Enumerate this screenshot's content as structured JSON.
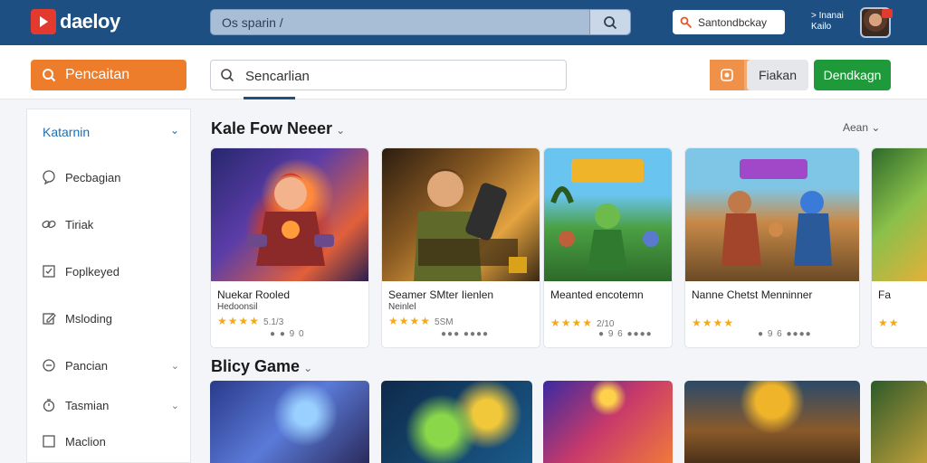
{
  "topbar": {
    "logo_text": "daeloy",
    "search_placeholder": "Os sparin  /",
    "pill_label": "Santondbckay",
    "user_line1": "> Inanai",
    "user_line2": "Kailo"
  },
  "subbar": {
    "orange_button": "Pencaitan",
    "search_value": "Sencarlian",
    "gray_button": "Fiakan",
    "green_button": "Dendkagn"
  },
  "sidebar": {
    "heading": "Katarnin",
    "items": [
      {
        "label": "Pecbagian",
        "icon": "chat-icon"
      },
      {
        "label": "Tiriak",
        "icon": "link-icon"
      },
      {
        "label": "Foplkeyed",
        "icon": "checkbox-icon"
      },
      {
        "label": "Msloding",
        "icon": "edit-icon"
      },
      {
        "label": "Pancian",
        "icon": "clock-icon"
      },
      {
        "label": "Tasmian",
        "icon": "timer-icon"
      },
      {
        "label": "Maclion",
        "icon": "square-icon"
      }
    ]
  },
  "section1": {
    "title": "Kale Fow Neeer",
    "more": "Aean",
    "cards": [
      {
        "title": "Nuekar Rooled",
        "sub": "Hedoonsil",
        "stars": "★★★★",
        "rating": "5.1/3",
        "foot": "● ● 9 0"
      },
      {
        "title": "Seamer SMter Iienlen",
        "sub": "Neinlel",
        "stars": "★★★★",
        "rating": "5SM",
        "foot": "●●● ●●●●"
      },
      {
        "title": "Meanted encotemn",
        "sub": "",
        "stars": "★★★★",
        "rating": "2/10",
        "foot": "● 9 6  ●●●●"
      },
      {
        "title": "Nanne Chetst Menninner",
        "sub": "",
        "stars": "★★★★",
        "rating": "",
        "foot": "● 9 6  ●●●●"
      },
      {
        "title": "Fa",
        "sub": "",
        "stars": "★★",
        "rating": "",
        "foot": ""
      }
    ]
  },
  "section2": {
    "title": "Blicy Game"
  },
  "colors": {
    "topbar": "#1d4f82",
    "orange": "#ee7d2b",
    "green": "#1f9a3a",
    "accent_blue": "#1d6fb5"
  }
}
